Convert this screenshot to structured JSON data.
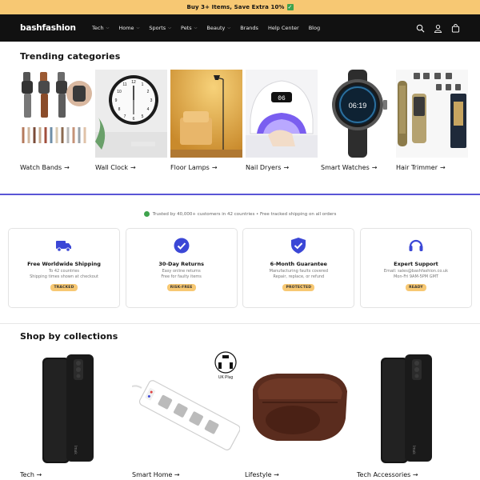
{
  "announcement": {
    "text": "Buy 3+ Items, Save Extra 10%"
  },
  "header": {
    "logo": "bashfashion",
    "nav": [
      {
        "label": "Tech",
        "dropdown": true
      },
      {
        "label": "Home",
        "dropdown": true
      },
      {
        "label": "Sports",
        "dropdown": true
      },
      {
        "label": "Pets",
        "dropdown": true
      },
      {
        "label": "Beauty",
        "dropdown": true
      },
      {
        "label": "Brands",
        "dropdown": false
      },
      {
        "label": "Help Center",
        "dropdown": false
      },
      {
        "label": "Blog",
        "dropdown": false
      }
    ],
    "icons": [
      "search-icon",
      "account-icon",
      "cart-icon"
    ]
  },
  "trending": {
    "title": "Trending categories",
    "items": [
      {
        "label": "Watch Bands"
      },
      {
        "label": "Wall Clock"
      },
      {
        "label": "Floor Lamps"
      },
      {
        "label": "Nail Dryers"
      },
      {
        "label": "Smart Watches"
      },
      {
        "label": "Hair Trimmer"
      }
    ],
    "arrow": "→",
    "lamp_display": "06",
    "watch_time": "06:19"
  },
  "trust": {
    "text": "Trusted by 40,000+ customers in 42 countries • Free tracked shipping on all orders"
  },
  "features": [
    {
      "icon": "truck-icon",
      "title": "Free Worldwide Shipping",
      "line1": "To 42 countries",
      "line2": "Shipping times shown at checkout",
      "badge": "TRACKED"
    },
    {
      "icon": "checkmark-circle-icon",
      "title": "30-Day Returns",
      "line1": "Easy online returns",
      "line2": "Free for faulty items",
      "badge": "RISK-FREE"
    },
    {
      "icon": "shield-check-icon",
      "title": "6-Month Guarantee",
      "line1": "Manufacturing faults covered",
      "line2": "Repair, replace, or refund",
      "badge": "PROTECTED"
    },
    {
      "icon": "headset-icon",
      "title": "Expert Support",
      "line1": "Email: sales@bashfashion.co.uk",
      "line2": "Mon-Fri 9AM-5PM GMT",
      "badge": "READY"
    }
  ],
  "collections": {
    "title": "Shop by collections",
    "items": [
      {
        "label": "Tech"
      },
      {
        "label": "Smart Home"
      },
      {
        "label": "Lifestyle"
      },
      {
        "label": "Tech Accessories"
      }
    ],
    "uk_plug_label": "UK Plug",
    "phone_brand": "Imak"
  },
  "colors": {
    "accent_bar": "#f7c873",
    "header_bg": "#111111",
    "divider": "#5a55d6",
    "icon_blue": "#3b47d6",
    "trust_green": "#3fa34d"
  }
}
